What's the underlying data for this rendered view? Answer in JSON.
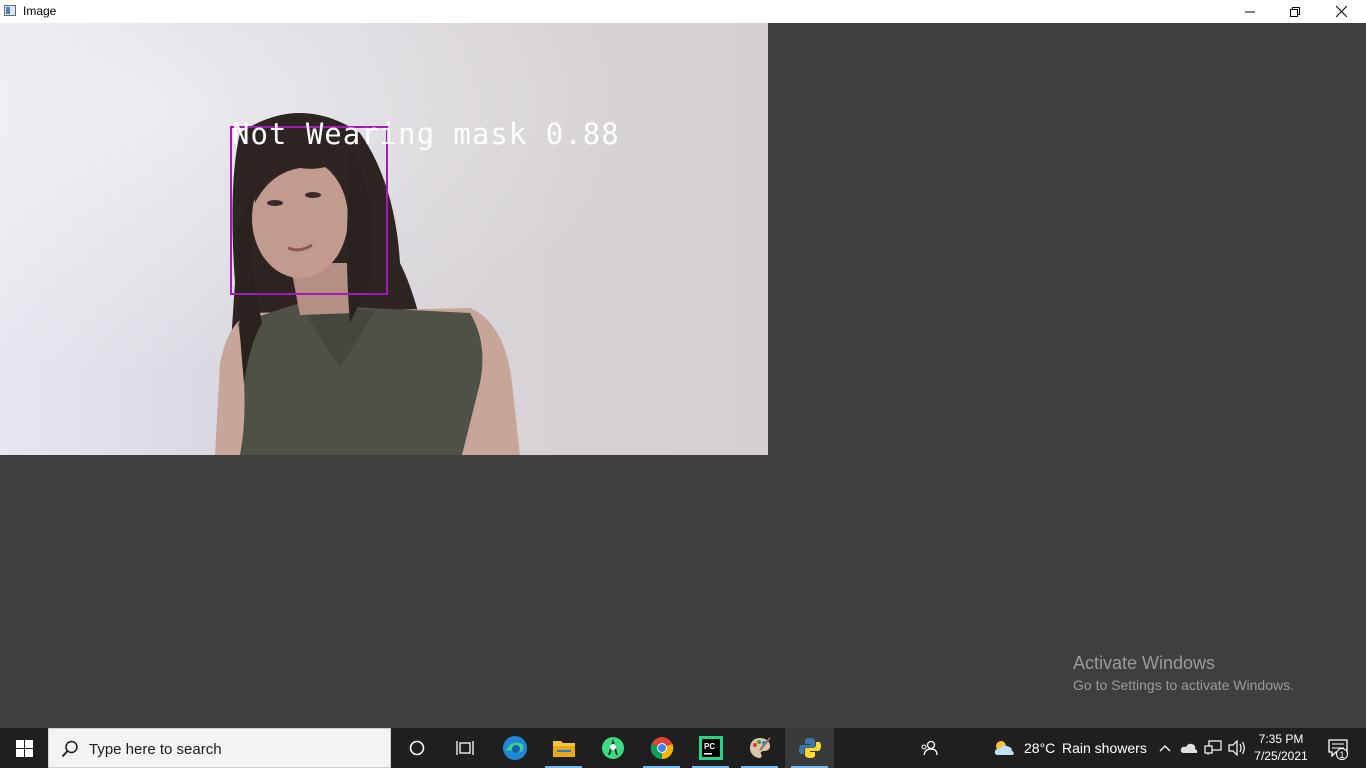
{
  "window": {
    "title": "Image",
    "controls": {
      "minimize": "minimize-icon",
      "maximize": "restore-icon",
      "close": "close-icon"
    }
  },
  "detection": {
    "label": "Not Wearing mask 0.88",
    "box_color": "#a21ab8",
    "text_color": "#ffffff"
  },
  "watermark": {
    "title": "Activate Windows",
    "subtitle": "Go to Settings to activate Windows."
  },
  "taskbar": {
    "start_icon": "windows-logo-icon",
    "search_placeholder": "Type here to search",
    "apps": [
      {
        "name": "cortana",
        "icon": "circle-icon"
      },
      {
        "name": "task-view",
        "icon": "task-view-icon"
      },
      {
        "name": "edge",
        "icon": "edge-icon"
      },
      {
        "name": "file-explorer",
        "icon": "folder-icon"
      },
      {
        "name": "android-studio",
        "icon": "android-studio-icon"
      },
      {
        "name": "chrome",
        "icon": "chrome-icon"
      },
      {
        "name": "pycharm",
        "icon": "pycharm-icon"
      },
      {
        "name": "paint",
        "icon": "palette-icon"
      },
      {
        "name": "python",
        "icon": "python-icon"
      }
    ],
    "weather": {
      "temperature": "28°C",
      "condition": "Rain showers"
    },
    "clock": {
      "time": "7:35 PM",
      "date": "7/25/2021"
    },
    "notifications_count": "1",
    "accent_color": "#76b9ed"
  }
}
